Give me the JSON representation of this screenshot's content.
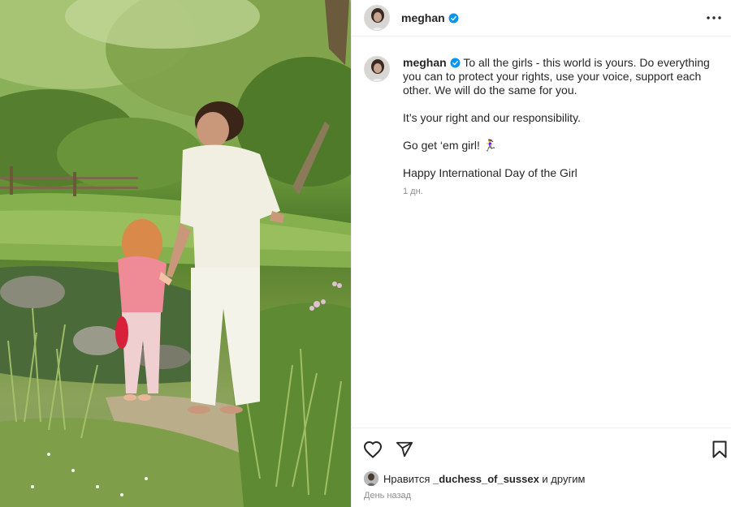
{
  "post": {
    "username": "meghan",
    "verified": true,
    "caption_paragraphs": [
      "To all the girls - this world is yours. Do everything you can to protect your rights, use your voice, support each other. We will do the same for you.",
      "It’s your right and our responsibility.",
      "Go get ‘em girl! 🏃‍♀️",
      "Happy International Day of the Girl"
    ],
    "timestamp": "1 дн.",
    "likes_prefix": "Нравится",
    "likes_user": "_duchess_of_sussex",
    "likes_suffix": "и другим",
    "date_label": "День назад"
  },
  "icons": {
    "like": "heart-icon",
    "share": "paper-plane-icon",
    "save": "bookmark-icon",
    "more": "more-dots-icon",
    "verified": "verified-badge-icon"
  },
  "colors": {
    "verified_blue": "#0095f6",
    "text": "#262626",
    "muted": "#8e8e8e",
    "divider": "#efefef"
  }
}
